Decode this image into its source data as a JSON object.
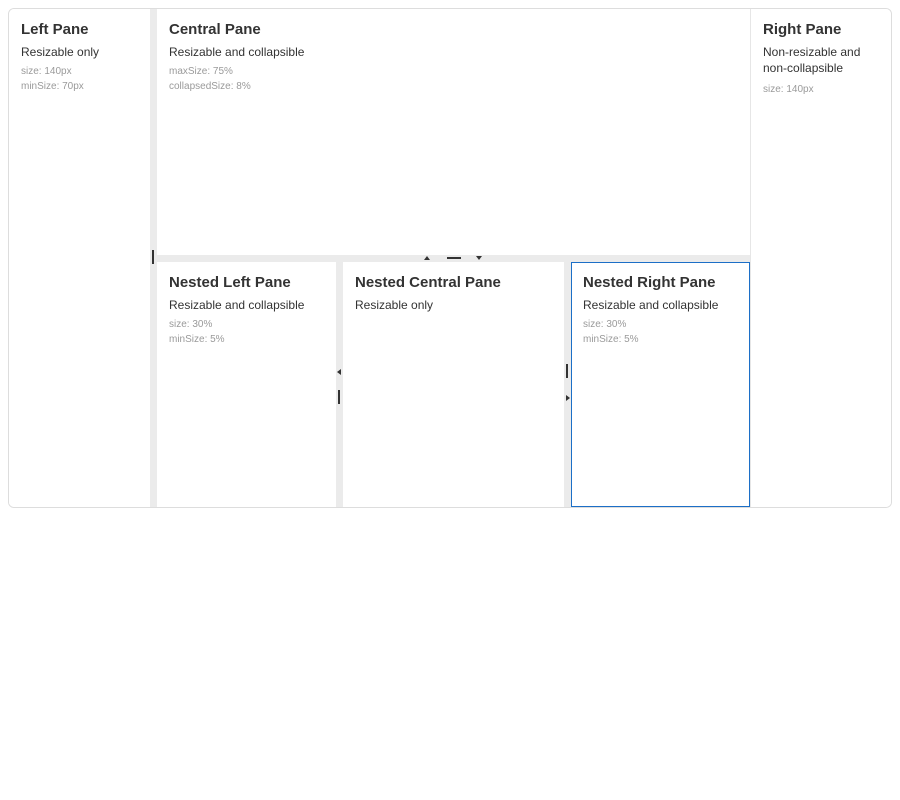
{
  "panes": {
    "left": {
      "title": "Left Pane",
      "description": "Resizable only",
      "meta": [
        "size: 140px",
        "minSize: 70px"
      ]
    },
    "central": {
      "title": "Central Pane",
      "description": "Resizable and collapsible",
      "meta": [
        "maxSize: 75%",
        "collapsedSize: 8%"
      ]
    },
    "right": {
      "title": "Right Pane",
      "description_lines": [
        "Non-resizable and",
        "non-collapsible"
      ],
      "meta": [
        "size: 140px"
      ]
    },
    "nested_left": {
      "title": "Nested Left Pane",
      "description": "Resizable and collapsible",
      "meta": [
        "size: 30%",
        "minSize: 5%"
      ]
    },
    "nested_central": {
      "title": "Nested Central Pane",
      "description": "Resizable only"
    },
    "nested_right": {
      "title": "Nested Right Pane",
      "description": "Resizable and collapsible",
      "meta": [
        "size: 30%",
        "minSize: 5%"
      ]
    }
  },
  "colors": {
    "border": "#dddddd",
    "splitter_bar": "#ebebeb",
    "focus_outline": "#1c6fc7",
    "meta_text": "#9a9a9a"
  },
  "icons": {
    "vertical_grip": "resize-handle-vertical-icon",
    "horizontal_grip": "resize-handle-horizontal-icon",
    "collapse_up": "collapse-up-icon",
    "collapse_down": "collapse-down-icon",
    "collapse_left": "collapse-left-icon",
    "collapse_right": "collapse-right-icon"
  }
}
